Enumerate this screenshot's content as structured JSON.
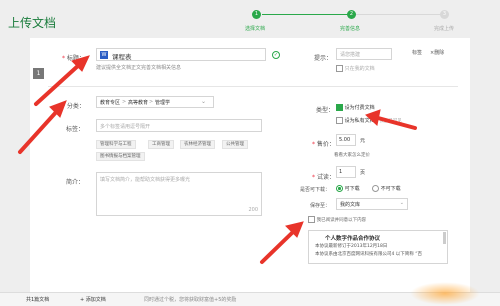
{
  "page": {
    "title": "上传文档"
  },
  "stepper": {
    "steps": [
      {
        "num": "1",
        "label": "选择文档"
      },
      {
        "num": "2",
        "label": "完善信息"
      },
      {
        "num": "3",
        "label": "完成上传"
      }
    ]
  },
  "side_badge": "1",
  "form": {
    "title": {
      "label": "标题：",
      "doc_type": "W",
      "value": "课程表",
      "hint": "建议提供全文档正文完善文档相关信息"
    },
    "tips_label": "提示：",
    "tips_select": "请您搭建",
    "tips_check": "只在我的文档",
    "actions": {
      "edit": "标签",
      "delete": "删除"
    },
    "category": {
      "label": "分类：",
      "path": [
        "教育专区",
        "高等教育",
        "管理学"
      ]
    },
    "tags": {
      "label": "标签：",
      "placeholder": "多个标签请用逗号隔开",
      "suggestions": [
        "管理科学与工程",
        "工商管理",
        "农林经济管理",
        "公共管理",
        "图书情报与档案管理"
      ]
    },
    "intro": {
      "label": "简介：",
      "placeholder": "填写文档简介，能帮助文档获得更多曝光",
      "counter": "200"
    },
    "type": {
      "label": "类型：",
      "paid": "设为付费文档",
      "private": "设为私有文档",
      "private_note": "仅自己可见"
    },
    "price": {
      "label": "售价：",
      "value": "5.00",
      "unit": "元",
      "link": "看看大家怎么定价"
    },
    "trial": {
      "label": "试读：",
      "value": "1",
      "unit": "页"
    },
    "download": {
      "label": "是否可下载：",
      "yes": "可下载",
      "no": "不可下载"
    },
    "save_to": {
      "label": "保存至：",
      "value": "我的文库"
    },
    "agreement": {
      "check_label": "我已阅读并同意以下内容",
      "title": "个人数字作品合作协议",
      "line1": "本协议最新修订于2013年12月18日",
      "line2": "本协议系由北京百度网讯科技有限公司4 以下简称 “百"
    }
  },
  "footer": {
    "count": "共1篇文档",
    "add": "添加文档",
    "notice": "同时通过个税，您将获取财富值+5的奖励"
  },
  "colors": {
    "green": "#2aa84a",
    "arrow": "#e8342a"
  }
}
